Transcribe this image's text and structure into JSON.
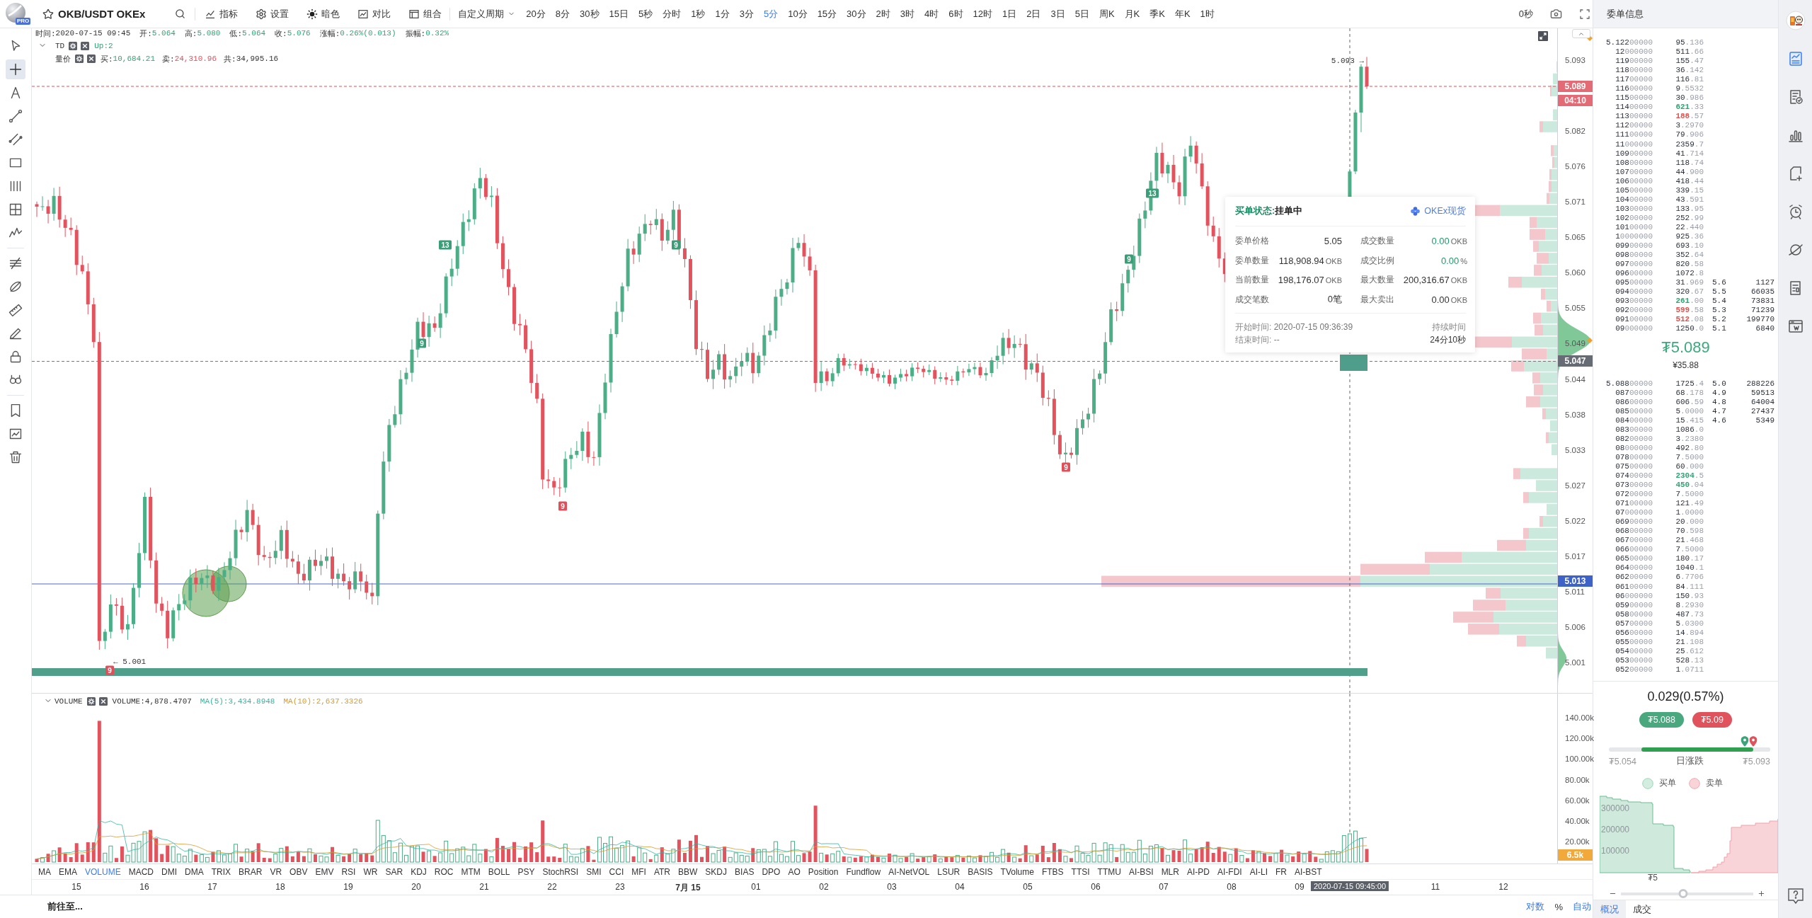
{
  "toolbar": {
    "logo_badge": "PRO",
    "symbol": "OKB/USDT OKEx",
    "tools": [
      {
        "kind": "indicators",
        "label": "指标"
      },
      {
        "kind": "settings",
        "label": "设置"
      },
      {
        "kind": "theme",
        "label": "暗色"
      },
      {
        "kind": "compare",
        "label": "对比"
      },
      {
        "kind": "layout",
        "label": "组合"
      }
    ],
    "custom_period": "自定义周期",
    "periods": [
      {
        "label": "20分",
        "selected": false
      },
      {
        "label": "8分",
        "selected": false
      },
      {
        "label": "30秒",
        "selected": false
      },
      {
        "label": "15日",
        "selected": false
      },
      {
        "label": "5秒",
        "selected": false
      },
      {
        "label": "分时",
        "selected": false
      },
      {
        "label": "1秒",
        "selected": false
      },
      {
        "label": "1分",
        "selected": false
      },
      {
        "label": "3分",
        "selected": false
      },
      {
        "label": "5分",
        "selected": true
      },
      {
        "label": "10分",
        "selected": false
      },
      {
        "label": "15分",
        "selected": false
      },
      {
        "label": "30分",
        "selected": false
      },
      {
        "label": "2时",
        "selected": false
      },
      {
        "label": "3时",
        "selected": false
      },
      {
        "label": "4时",
        "selected": false
      },
      {
        "label": "6时",
        "selected": false
      },
      {
        "label": "12时",
        "selected": false
      },
      {
        "label": "1日",
        "selected": false
      },
      {
        "label": "2日",
        "selected": false
      },
      {
        "label": "3日",
        "selected": false
      },
      {
        "label": "5日",
        "selected": false
      },
      {
        "label": "周K",
        "selected": false
      },
      {
        "label": "月K",
        "selected": false
      },
      {
        "label": "季K",
        "selected": false
      },
      {
        "label": "年K",
        "selected": false
      },
      {
        "label": "1时",
        "selected": false
      }
    ],
    "refresh": "0秒"
  },
  "drawing_tools": [
    {
      "kind": "cursor",
      "selected": false
    },
    {
      "kind": "crosshair",
      "selected": true
    },
    {
      "kind": "text",
      "selected": false
    },
    {
      "kind": "trend-line",
      "selected": false
    },
    {
      "kind": "parallel",
      "selected": false
    },
    {
      "kind": "rectangle",
      "selected": false
    },
    {
      "kind": "vertical-lines",
      "selected": false
    },
    {
      "kind": "grid",
      "selected": false
    },
    {
      "kind": "zigzag",
      "selected": false
    },
    {
      "kind": "striped",
      "selected": false
    },
    {
      "kind": "ellipse",
      "selected": false
    },
    {
      "kind": "ruler",
      "selected": false
    },
    {
      "kind": "pen",
      "selected": false
    },
    {
      "kind": "lock",
      "selected": false
    },
    {
      "kind": "rings",
      "selected": false
    },
    {
      "kind": "bookmark",
      "selected": false
    },
    {
      "kind": "chart-image",
      "selected": false
    },
    {
      "kind": "trash",
      "selected": false
    }
  ],
  "info_line": [
    {
      "label": "时间:",
      "value": "2020-07-15 09:45"
    },
    {
      "label": "开:",
      "value": "5.064",
      "color": "#2ea676"
    },
    {
      "label": "高:",
      "value": "5.080",
      "color": "#2ea676"
    },
    {
      "label": "低:",
      "value": "5.064",
      "color": "#2ea676"
    },
    {
      "label": "收:",
      "value": "5.076",
      "color": "#2ea676"
    },
    {
      "label": "涨幅:",
      "value": "0.26%(0.013)",
      "color": "#2ea676"
    },
    {
      "label": "振幅:",
      "value": "0.32%",
      "color": "#2ea676"
    }
  ],
  "overlays": [
    {
      "name": "TD",
      "expanded": true,
      "values": [
        {
          "text": "Up:2",
          "color": "#2ea676"
        }
      ]
    },
    {
      "name": "量价",
      "values": [
        {
          "label": "买:",
          "value": "10,684.21",
          "color": "#2ea676"
        },
        {
          "label": "卖:",
          "value": "24,310.96",
          "color": "#e4505b"
        },
        {
          "label": "共:",
          "value": "34,995.16"
        }
      ]
    }
  ],
  "chart": {
    "max_label": "5.093 →",
    "min_label": "← 5.001",
    "td_marks": [
      {
        "label": "9",
        "kind": "down"
      },
      {
        "label": "9",
        "kind": "up"
      },
      {
        "label": "13",
        "kind": "up"
      },
      {
        "label": "9",
        "kind": "down"
      },
      {
        "label": "9",
        "kind": "up"
      },
      {
        "label": "9",
        "kind": "down"
      },
      {
        "label": "9",
        "kind": "up"
      },
      {
        "label": "13",
        "kind": "up"
      }
    ],
    "price_ticks": [
      "5.093",
      "5.082",
      "5.076",
      "5.071",
      "5.065",
      "5.060",
      "5.055",
      "5.049",
      "5.044",
      "5.038",
      "5.033",
      "5.027",
      "5.022",
      "5.017",
      "5.011",
      "5.006",
      "5.001"
    ],
    "price_markers": [
      {
        "kind": "last",
        "text": "5.089"
      },
      {
        "kind": "countdown",
        "text": "04:10"
      },
      {
        "kind": "crosshair",
        "text": "5.047"
      },
      {
        "kind": "line",
        "text": "5.013"
      }
    ]
  },
  "order_popup": {
    "status_label": "买单状态:",
    "status": "挂单中",
    "source": "OKEx现货",
    "fields": [
      {
        "label": "委单价格",
        "value": "5.05",
        "highlight": false
      },
      {
        "label": "成交数量",
        "value": "0.00",
        "unit": "OKB",
        "highlight": true
      },
      {
        "label": "委单数量",
        "value": "118,908.94",
        "unit": "OKB",
        "highlight": false
      },
      {
        "label": "成交比例",
        "value": "0.00",
        "unit": "%",
        "highlight": true
      },
      {
        "label": "当前数量",
        "value": "198,176.07",
        "unit": "OKB",
        "highlight": false
      },
      {
        "label": "最大数量",
        "value": "200,316.67",
        "unit": "OKB",
        "highlight": false
      },
      {
        "label": "成交笔数",
        "value": "0笔",
        "highlight": false
      },
      {
        "label": "最大卖出",
        "value": "0.00",
        "unit": "OKB",
        "highlight": false
      }
    ],
    "start_label": "开始时间:",
    "start": "2020-07-15 09:36:39",
    "end_label": "结束时间:",
    "end": "--",
    "duration_label": "持续时间",
    "duration": "24分10秒"
  },
  "volume": {
    "name": "VOLUME",
    "expanded": true,
    "values": [
      {
        "text": "VOLUME:4,878.4707"
      },
      {
        "text": "MA(5):3,434.8948",
        "color": "#2fb8a3"
      },
      {
        "text": "MA(10):2,637.3326",
        "color": "#d99b2c"
      }
    ],
    "ticks": [
      "140.00k",
      "120.00k",
      "100.00k",
      "80.00k",
      "60.00k",
      "40.00k",
      "20.00k"
    ],
    "marker": "6.5k"
  },
  "indicator_tabs": [
    {
      "label": "MA",
      "selected": false
    },
    {
      "label": "EMA",
      "selected": false
    },
    {
      "label": "VOLUME",
      "selected": true
    },
    {
      "label": "MACD",
      "selected": false
    },
    {
      "label": "DMI",
      "selected": false
    },
    {
      "label": "DMA",
      "selected": false
    },
    {
      "label": "TRIX",
      "selected": false
    },
    {
      "label": "BRAR",
      "selected": false
    },
    {
      "label": "VR",
      "selected": false
    },
    {
      "label": "OBV",
      "selected": false
    },
    {
      "label": "EMV",
      "selected": false
    },
    {
      "label": "RSI",
      "selected": false
    },
    {
      "label": "WR",
      "selected": false
    },
    {
      "label": "SAR",
      "selected": false
    },
    {
      "label": "KDJ",
      "selected": false
    },
    {
      "label": "ROC",
      "selected": false
    },
    {
      "label": "MTM",
      "selected": false
    },
    {
      "label": "BOLL",
      "selected": false
    },
    {
      "label": "PSY",
      "selected": false
    },
    {
      "label": "StochRSI",
      "selected": false
    },
    {
      "label": "SMI",
      "selected": false
    },
    {
      "label": "CCI",
      "selected": false
    },
    {
      "label": "MFI",
      "selected": false
    },
    {
      "label": "ATR",
      "selected": false
    },
    {
      "label": "BBW",
      "selected": false
    },
    {
      "label": "SKDJ",
      "selected": false
    },
    {
      "label": "BIAS",
      "selected": false
    },
    {
      "label": "DPO",
      "selected": false
    },
    {
      "label": "AO",
      "selected": false
    },
    {
      "label": "Position",
      "selected": false
    },
    {
      "label": "Fundflow",
      "selected": false
    },
    {
      "label": "AI-NetVOL",
      "selected": false
    },
    {
      "label": "LSUR",
      "selected": false
    },
    {
      "label": "BASIS",
      "selected": false
    },
    {
      "label": "TVolume",
      "selected": false
    },
    {
      "label": "FTBS",
      "selected": false
    },
    {
      "label": "TTSI",
      "selected": false
    },
    {
      "label": "TTMU",
      "selected": false
    },
    {
      "label": "AI-BSI",
      "selected": false
    },
    {
      "label": "MLR",
      "selected": false
    },
    {
      "label": "AI-PD",
      "selected": false
    },
    {
      "label": "AI-FDI",
      "selected": false
    },
    {
      "label": "AI-LI",
      "selected": false
    },
    {
      "label": "FR",
      "selected": false
    },
    {
      "label": "AI-BST",
      "selected": false
    }
  ],
  "time_axis": {
    "labels": [
      {
        "text": "15",
        "kind": "hour"
      },
      {
        "text": "16",
        "kind": "hour"
      },
      {
        "text": "17",
        "kind": "hour"
      },
      {
        "text": "18",
        "kind": "hour"
      },
      {
        "text": "19",
        "kind": "hour"
      },
      {
        "text": "20",
        "kind": "hour"
      },
      {
        "text": "21",
        "kind": "hour"
      },
      {
        "text": "22",
        "kind": "hour"
      },
      {
        "text": "23",
        "kind": "hour"
      },
      {
        "text": "7月 15",
        "kind": "day"
      },
      {
        "text": "01",
        "kind": "hour"
      },
      {
        "text": "02",
        "kind": "hour"
      },
      {
        "text": "03",
        "kind": "hour"
      },
      {
        "text": "04",
        "kind": "hour"
      },
      {
        "text": "05",
        "kind": "hour"
      },
      {
        "text": "06",
        "kind": "hour"
      },
      {
        "text": "07",
        "kind": "hour"
      },
      {
        "text": "08",
        "kind": "hour"
      },
      {
        "text": "09",
        "kind": "hour"
      },
      {
        "text": "11",
        "kind": "hour"
      },
      {
        "text": "12",
        "kind": "hour"
      }
    ],
    "crosshair": "2020-07-15 09:45:00"
  },
  "bottom_bar": {
    "goto": "前往至...",
    "options": [
      {
        "label": "对数",
        "on": true
      },
      {
        "label": "%",
        "on": false
      },
      {
        "label": "自动",
        "on": true
      }
    ]
  },
  "order_book": {
    "title": "委单信息",
    "asks": [
      {
        "price": "5.12200000",
        "amount": "95.136"
      },
      {
        "price": "12000000",
        "amount": "511.66"
      },
      {
        "price": "11900000",
        "amount": "155.47"
      },
      {
        "price": "11800000",
        "amount": "36.142"
      },
      {
        "price": "11700000",
        "amount": "116.81"
      },
      {
        "price": "11600000",
        "amount": "9.5532"
      },
      {
        "price": "11500000",
        "amount": "30.986"
      },
      {
        "price": "11400000",
        "amount": "621.33",
        "color": "#2ea676"
      },
      {
        "price": "11300000",
        "amount": "188.57",
        "color": "#e4504b"
      },
      {
        "price": "11200000",
        "amount": "3.2970"
      },
      {
        "price": "11100000",
        "amount": "79.906"
      },
      {
        "price": "11000000",
        "amount": "2359.7"
      },
      {
        "price": "10900000",
        "amount": "41.714"
      },
      {
        "price": "10800000",
        "amount": "118.74"
      },
      {
        "price": "10700000",
        "amount": "44.900"
      },
      {
        "price": "10600000",
        "amount": "418.44"
      },
      {
        "price": "10500000",
        "amount": "339.15"
      },
      {
        "price": "10400000",
        "amount": "43.591"
      },
      {
        "price": "10300000",
        "amount": "133.95"
      },
      {
        "price": "10200000",
        "amount": "252.99"
      },
      {
        "price": "10100000",
        "amount": "22.440"
      },
      {
        "price": "10000000",
        "amount": "925.36"
      },
      {
        "price": "09900000",
        "amount": "693.10"
      },
      {
        "price": "09800000",
        "amount": "352.64"
      },
      {
        "price": "09700000",
        "amount": "820.58"
      },
      {
        "price": "09600000",
        "amount": "1072.8"
      },
      {
        "price": "09500000",
        "amount": "31.969",
        "column_3": "5.6",
        "column_4": "1127"
      },
      {
        "price": "09400000",
        "amount": "320.67",
        "column_3": "5.5",
        "column_4": "66035"
      },
      {
        "price": "09300000",
        "amount": "261.00",
        "color": "#2ea676",
        "column_3": "5.4",
        "column_4": "73831"
      },
      {
        "price": "09200000",
        "amount": "599.58",
        "color": "#e4504b",
        "column_3": "5.3",
        "column_4": "71239"
      },
      {
        "price": "09100000",
        "amount": "512.08",
        "color": "#e4504b",
        "column_3": "5.2",
        "column_4": "199770"
      },
      {
        "price": "09000000",
        "amount": "1250.0",
        "column_3": "5.1",
        "column_4": "6840"
      }
    ],
    "last_price": "₮5.089",
    "last_price_cny": "¥35.88",
    "bids": [
      {
        "price": "5.08800000",
        "amount": "1725.4",
        "column_3": "5.0",
        "column_4": "288226"
      },
      {
        "price": "08700000",
        "amount": "68.178",
        "column_3": "4.9",
        "column_4": "59513"
      },
      {
        "price": "08600000",
        "amount": "606.59",
        "column_3": "4.8",
        "column_4": "64004"
      },
      {
        "price": "08500000",
        "amount": "5.0000",
        "column_3": "4.7",
        "column_4": "27437"
      },
      {
        "price": "08400000",
        "amount": "15.415",
        "column_3": "4.6",
        "column_4": "5349"
      },
      {
        "price": "08300000",
        "amount": "1086.0"
      },
      {
        "price": "08200000",
        "amount": "3.2380"
      },
      {
        "price": "08000000",
        "amount": "492.80"
      },
      {
        "price": "07800000",
        "amount": "7.5000"
      },
      {
        "price": "07500000",
        "amount": "60.000"
      },
      {
        "price": "07400000",
        "amount": "2304.5",
        "color": "#2ea676"
      },
      {
        "price": "07300000",
        "amount": "450.04",
        "color": "#2ea676"
      },
      {
        "price": "07200000",
        "amount": "7.5000"
      },
      {
        "price": "07100000",
        "amount": "121.49"
      },
      {
        "price": "07000000",
        "amount": "1.0000"
      },
      {
        "price": "06900000",
        "amount": "20.000"
      },
      {
        "price": "06800000",
        "amount": "70.598"
      },
      {
        "price": "06700000",
        "amount": "21.468"
      },
      {
        "price": "06600000",
        "amount": "7.5000"
      },
      {
        "price": "06500000",
        "amount": "180.17"
      },
      {
        "price": "06400000",
        "amount": "1040.1"
      },
      {
        "price": "06200000",
        "amount": "6.7706"
      },
      {
        "price": "06100000",
        "amount": "84.111"
      },
      {
        "price": "06000000",
        "amount": "150.93"
      },
      {
        "price": "05900000",
        "amount": "8.2930"
      },
      {
        "price": "05800000",
        "amount": "487.73"
      },
      {
        "price": "05700000",
        "amount": "5.0300"
      },
      {
        "price": "05600000",
        "amount": "14.894"
      },
      {
        "price": "05500000",
        "amount": "21.108"
      },
      {
        "price": "05400000",
        "amount": "25.612"
      },
      {
        "price": "05300000",
        "amount": "528.13"
      },
      {
        "price": "05200000",
        "amount": "1.0711"
      }
    ],
    "change": "0.029(0.57%)",
    "bid_button": "₮5.088",
    "ask_button": "₮5.09",
    "range": {
      "level": 0.87
    },
    "range_low": "₮5.054",
    "range_label": "日涨跌",
    "range_high": "₮5.093",
    "legend": [
      {
        "label": "买单",
        "kind": "buy"
      },
      {
        "label": "卖单",
        "kind": "sell"
      }
    ],
    "depth_chart": {
      "y_labels": [
        "300000",
        "200000",
        "100000"
      ],
      "x_label": "₮5"
    },
    "zoom_slider": {
      "level": 0.47
    },
    "tabs": [
      {
        "label": "概况",
        "selected": true
      },
      {
        "label": "成交",
        "selected": false
      }
    ]
  },
  "side_rail": [
    {
      "kind": "chart-report",
      "selected": true
    },
    {
      "kind": "doc-check",
      "selected": false
    },
    {
      "kind": "bar-chart",
      "selected": false
    },
    {
      "kind": "file-plus",
      "selected": false
    },
    {
      "kind": "alarm",
      "selected": false
    },
    {
      "kind": "planet",
      "selected": false
    },
    {
      "kind": "doc-list",
      "selected": false
    },
    {
      "kind": "window",
      "selected": false
    }
  ]
}
